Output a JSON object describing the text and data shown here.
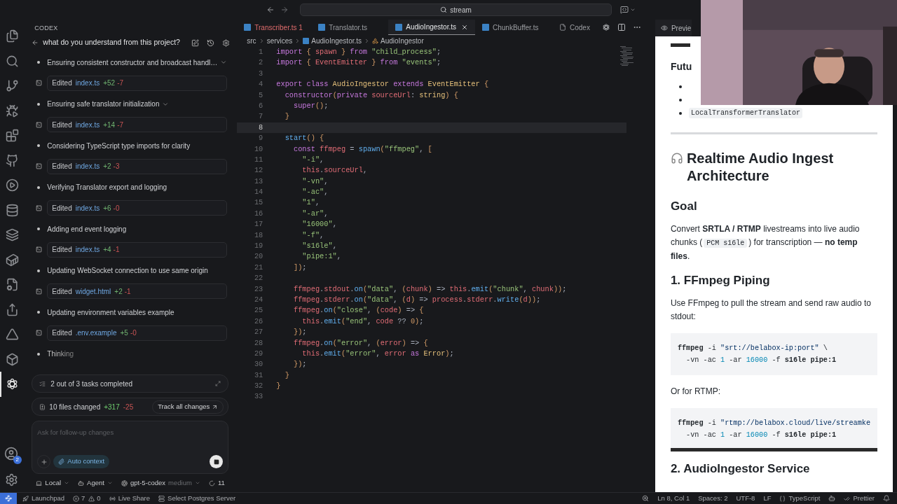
{
  "title_bar": {
    "search": "stream"
  },
  "activity_bar": {
    "items": [
      {
        "kind": "files",
        "selected": false
      },
      {
        "kind": "search",
        "selected": false
      },
      {
        "kind": "branch",
        "selected": false
      },
      {
        "kind": "debug",
        "selected": false
      },
      {
        "kind": "blocks",
        "selected": false
      },
      {
        "kind": "github",
        "selected": false
      },
      {
        "kind": "play",
        "selected": false
      },
      {
        "kind": "database",
        "selected": false
      },
      {
        "kind": "layers",
        "selected": false
      },
      {
        "kind": "container",
        "selected": false
      },
      {
        "kind": "filecog",
        "selected": false
      },
      {
        "kind": "remote",
        "selected": false
      },
      {
        "kind": "triangle",
        "selected": false
      },
      {
        "kind": "box",
        "selected": false
      },
      {
        "kind": "knot",
        "selected": true
      }
    ],
    "account_badge": "2"
  },
  "codex": {
    "header": "CODEX",
    "thread_title": "what do you understand from this project?",
    "timeline": [
      {
        "kind": "step",
        "text": "Ensuring consistent constructor and broadcast handl…",
        "expandable": true
      },
      {
        "kind": "edit",
        "action": "Edited",
        "file": "index.ts",
        "added": "+52",
        "removed": "-7"
      },
      {
        "kind": "step",
        "text": "Ensuring safe translator initialization",
        "expandable": true
      },
      {
        "kind": "edit",
        "action": "Edited",
        "file": "index.ts",
        "added": "+14",
        "removed": "-7"
      },
      {
        "kind": "step",
        "text": "Considering TypeScript type imports for clarity",
        "expandable": false
      },
      {
        "kind": "edit",
        "action": "Edited",
        "file": "index.ts",
        "added": "+2",
        "removed": "-3"
      },
      {
        "kind": "step",
        "text": "Verifying Translator export and logging",
        "expandable": false
      },
      {
        "kind": "edit",
        "action": "Edited",
        "file": "index.ts",
        "added": "+6",
        "removed": "-0"
      },
      {
        "kind": "step",
        "text": "Adding end event logging",
        "expandable": false
      },
      {
        "kind": "edit",
        "action": "Edited",
        "file": "index.ts",
        "added": "+4",
        "removed": "-1"
      },
      {
        "kind": "step",
        "text": "Updating WebSocket connection to use same origin",
        "expandable": false
      },
      {
        "kind": "edit",
        "action": "Edited",
        "file": "widget.html",
        "added": "+2",
        "removed": "-1"
      },
      {
        "kind": "step",
        "text": "Updating environment variables example",
        "expandable": false
      },
      {
        "kind": "edit",
        "action": "Edited",
        "file": ".env.example",
        "added": "+5",
        "removed": "-0"
      },
      {
        "kind": "thinking",
        "text": "Thinking"
      }
    ],
    "tasks": "2 out of 3 tasks completed",
    "changes": {
      "summary": "10 files changed",
      "added": "+317",
      "removed": "-25",
      "button": "Track all changes"
    },
    "input": {
      "placeholder": "Ask for follow-up changes",
      "context_chip": "Auto context"
    },
    "footer": [
      {
        "kind": "local",
        "label": "Local"
      },
      {
        "kind": "agent",
        "label": "Agent"
      },
      {
        "kind": "model",
        "label": "gpt-5-codex",
        "detail": "medium"
      },
      {
        "kind": "usage",
        "label": "11"
      }
    ]
  },
  "editor": {
    "tabs": [
      {
        "kind": "ts",
        "label": "Transcriber.ts",
        "problems": "1",
        "error": true,
        "selected": false
      },
      {
        "kind": "ts",
        "label": "Translator.ts",
        "error": false,
        "selected": false
      },
      {
        "kind": "ts",
        "label": "AudioIngestor.ts",
        "error": false,
        "selected": true
      },
      {
        "kind": "ts",
        "label": "ChunkBuffer.ts",
        "error": false,
        "selected": false
      },
      {
        "kind": "doc",
        "label": "Codex",
        "error": false,
        "selected": false
      }
    ],
    "breadcrumb": [
      {
        "kind": "folder",
        "label": "src"
      },
      {
        "kind": "folder",
        "label": "services"
      },
      {
        "kind": "file",
        "label": "AudioIngestor.ts"
      },
      {
        "kind": "symbol",
        "label": "AudioIngestor"
      }
    ],
    "lines": [
      {
        "n": "1",
        "current": false,
        "tokens": [
          {
            "kind": "kw",
            "text": "import"
          },
          {
            "kind": "br",
            "text": " {"
          },
          {
            "kind": "var",
            "text": " spawn"
          },
          {
            "kind": "br",
            "text": " }"
          },
          {
            "kind": "kw",
            "text": " from"
          },
          {
            "kind": "str",
            "text": " \"child_process\""
          },
          {
            "kind": "p",
            "text": ";"
          }
        ]
      },
      {
        "n": "2",
        "current": false,
        "tokens": [
          {
            "kind": "kw",
            "text": "import"
          },
          {
            "kind": "br",
            "text": " {"
          },
          {
            "kind": "var",
            "text": " EventEmitter"
          },
          {
            "kind": "br",
            "text": " }"
          },
          {
            "kind": "kw",
            "text": " from"
          },
          {
            "kind": "str",
            "text": " \"events\""
          },
          {
            "kind": "p",
            "text": ";"
          }
        ]
      },
      {
        "n": "3",
        "current": false
      },
      {
        "n": "4",
        "current": false,
        "tokens": [
          {
            "kind": "kw",
            "text": "export"
          },
          {
            "kind": "kw",
            "text": " class"
          },
          {
            "kind": "cls",
            "text": " AudioIngestor"
          },
          {
            "kind": "kw",
            "text": " extends"
          },
          {
            "kind": "cls",
            "text": " EventEmitter"
          },
          {
            "kind": "br",
            "text": " {"
          }
        ]
      },
      {
        "n": "5",
        "current": false,
        "tokens": [
          {
            "kind": "kw",
            "text": "  constructor"
          },
          {
            "kind": "br",
            "text": "("
          },
          {
            "kind": "kw",
            "text": "private"
          },
          {
            "kind": "var",
            "text": " sourceUrl"
          },
          {
            "kind": "p",
            "text": ":"
          },
          {
            "kind": "cls",
            "text": " string"
          },
          {
            "kind": "br",
            "text": ")"
          },
          {
            "kind": "br",
            "text": " {"
          }
        ]
      },
      {
        "n": "6",
        "current": false,
        "tokens": [
          {
            "kind": "kw",
            "text": "    super"
          },
          {
            "kind": "br",
            "text": "()"
          },
          {
            "kind": "p",
            "text": ";"
          }
        ]
      },
      {
        "n": "7",
        "current": false,
        "tokens": [
          {
            "kind": "br",
            "text": "  }"
          }
        ]
      },
      {
        "n": "8",
        "current": true
      },
      {
        "n": "9",
        "current": false,
        "tokens": [
          {
            "kind": "fn",
            "text": "  start"
          },
          {
            "kind": "br",
            "text": "()"
          },
          {
            "kind": "br",
            "text": " {"
          }
        ]
      },
      {
        "n": "10",
        "current": false,
        "tokens": [
          {
            "kind": "kw",
            "text": "    const"
          },
          {
            "kind": "var",
            "text": " ffmpeg"
          },
          {
            "kind": "p",
            "text": " ="
          },
          {
            "kind": "fn",
            "text": " spawn"
          },
          {
            "kind": "br",
            "text": "("
          },
          {
            "kind": "str",
            "text": "\"ffmpeg\""
          },
          {
            "kind": "p",
            "text": ","
          },
          {
            "kind": "br",
            "text": " ["
          }
        ]
      },
      {
        "n": "11",
        "current": false,
        "tokens": [
          {
            "kind": "str",
            "text": "      \"-i\""
          },
          {
            "kind": "p",
            "text": ","
          }
        ]
      },
      {
        "n": "12",
        "current": false,
        "tokens": [
          {
            "kind": "var",
            "text": "      this"
          },
          {
            "kind": "p",
            "text": "."
          },
          {
            "kind": "var",
            "text": "sourceUrl"
          },
          {
            "kind": "p",
            "text": ","
          }
        ]
      },
      {
        "n": "13",
        "current": false,
        "tokens": [
          {
            "kind": "str",
            "text": "      \"-vn\""
          },
          {
            "kind": "p",
            "text": ","
          }
        ]
      },
      {
        "n": "14",
        "current": false,
        "tokens": [
          {
            "kind": "str",
            "text": "      \"-ac\""
          },
          {
            "kind": "p",
            "text": ","
          }
        ]
      },
      {
        "n": "15",
        "current": false,
        "tokens": [
          {
            "kind": "str",
            "text": "      \"1\""
          },
          {
            "kind": "p",
            "text": ","
          }
        ]
      },
      {
        "n": "16",
        "current": false,
        "tokens": [
          {
            "kind": "str",
            "text": "      \"-ar\""
          },
          {
            "kind": "p",
            "text": ","
          }
        ]
      },
      {
        "n": "17",
        "current": false,
        "tokens": [
          {
            "kind": "str",
            "text": "      \"16000\""
          },
          {
            "kind": "p",
            "text": ","
          }
        ]
      },
      {
        "n": "18",
        "current": false,
        "tokens": [
          {
            "kind": "str",
            "text": "      \"-f\""
          },
          {
            "kind": "p",
            "text": ","
          }
        ]
      },
      {
        "n": "19",
        "current": false,
        "tokens": [
          {
            "kind": "str",
            "text": "      \"s16le\""
          },
          {
            "kind": "p",
            "text": ","
          }
        ]
      },
      {
        "n": "20",
        "current": false,
        "tokens": [
          {
            "kind": "str",
            "text": "      \"pipe:1\""
          },
          {
            "kind": "p",
            "text": ","
          }
        ]
      },
      {
        "n": "21",
        "current": false,
        "tokens": [
          {
            "kind": "br",
            "text": "    ])"
          },
          {
            "kind": "p",
            "text": ";"
          }
        ]
      },
      {
        "n": "22",
        "current": false
      },
      {
        "n": "23",
        "current": false,
        "tokens": [
          {
            "kind": "var",
            "text": "    ffmpeg"
          },
          {
            "kind": "p",
            "text": "."
          },
          {
            "kind": "var",
            "text": "stdout"
          },
          {
            "kind": "p",
            "text": "."
          },
          {
            "kind": "fn",
            "text": "on"
          },
          {
            "kind": "br",
            "text": "("
          },
          {
            "kind": "str",
            "text": "\"data\""
          },
          {
            "kind": "p",
            "text": ","
          },
          {
            "kind": "br",
            "text": " ("
          },
          {
            "kind": "var",
            "text": "chunk"
          },
          {
            "kind": "br",
            "text": ")"
          },
          {
            "kind": "p",
            "text": " =>"
          },
          {
            "kind": "var",
            "text": " this"
          },
          {
            "kind": "p",
            "text": "."
          },
          {
            "kind": "fn",
            "text": "emit"
          },
          {
            "kind": "br",
            "text": "("
          },
          {
            "kind": "str",
            "text": "\"chunk\""
          },
          {
            "kind": "p",
            "text": ","
          },
          {
            "kind": "var",
            "text": " chunk"
          },
          {
            "kind": "br",
            "text": "))"
          },
          {
            "kind": "p",
            "text": ";"
          }
        ]
      },
      {
        "n": "24",
        "current": false,
        "tokens": [
          {
            "kind": "var",
            "text": "    ffmpeg"
          },
          {
            "kind": "p",
            "text": "."
          },
          {
            "kind": "var",
            "text": "stderr"
          },
          {
            "kind": "p",
            "text": "."
          },
          {
            "kind": "fn",
            "text": "on"
          },
          {
            "kind": "br",
            "text": "("
          },
          {
            "kind": "str",
            "text": "\"data\""
          },
          {
            "kind": "p",
            "text": ","
          },
          {
            "kind": "br",
            "text": " ("
          },
          {
            "kind": "var",
            "text": "d"
          },
          {
            "kind": "br",
            "text": ")"
          },
          {
            "kind": "p",
            "text": " =>"
          },
          {
            "kind": "var",
            "text": " process"
          },
          {
            "kind": "p",
            "text": "."
          },
          {
            "kind": "var",
            "text": "stderr"
          },
          {
            "kind": "p",
            "text": "."
          },
          {
            "kind": "fn",
            "text": "write"
          },
          {
            "kind": "br",
            "text": "("
          },
          {
            "kind": "var",
            "text": "d"
          },
          {
            "kind": "br",
            "text": "))"
          },
          {
            "kind": "p",
            "text": ";"
          }
        ]
      },
      {
        "n": "25",
        "current": false,
        "tokens": [
          {
            "kind": "var",
            "text": "    ffmpeg"
          },
          {
            "kind": "p",
            "text": "."
          },
          {
            "kind": "fn",
            "text": "on"
          },
          {
            "kind": "br",
            "text": "("
          },
          {
            "kind": "str",
            "text": "\"close\""
          },
          {
            "kind": "p",
            "text": ","
          },
          {
            "kind": "br",
            "text": " ("
          },
          {
            "kind": "var",
            "text": "code"
          },
          {
            "kind": "br",
            "text": ")"
          },
          {
            "kind": "p",
            "text": " =>"
          },
          {
            "kind": "br",
            "text": " {"
          }
        ]
      },
      {
        "n": "26",
        "current": false,
        "tokens": [
          {
            "kind": "var",
            "text": "      this"
          },
          {
            "kind": "p",
            "text": "."
          },
          {
            "kind": "fn",
            "text": "emit"
          },
          {
            "kind": "br",
            "text": "("
          },
          {
            "kind": "str",
            "text": "\"end\""
          },
          {
            "kind": "p",
            "text": ","
          },
          {
            "kind": "var",
            "text": " code"
          },
          {
            "kind": "p",
            "text": " ??"
          },
          {
            "kind": "num",
            "text": " 0"
          },
          {
            "kind": "br",
            "text": ")"
          },
          {
            "kind": "p",
            "text": ";"
          }
        ]
      },
      {
        "n": "27",
        "current": false,
        "tokens": [
          {
            "kind": "br",
            "text": "    })"
          },
          {
            "kind": "p",
            "text": ";"
          }
        ]
      },
      {
        "n": "28",
        "current": false,
        "tokens": [
          {
            "kind": "var",
            "text": "    ffmpeg"
          },
          {
            "kind": "p",
            "text": "."
          },
          {
            "kind": "fn",
            "text": "on"
          },
          {
            "kind": "br",
            "text": "("
          },
          {
            "kind": "str",
            "text": "\"error\""
          },
          {
            "kind": "p",
            "text": ","
          },
          {
            "kind": "br",
            "text": " ("
          },
          {
            "kind": "var",
            "text": "error"
          },
          {
            "kind": "br",
            "text": ")"
          },
          {
            "kind": "p",
            "text": " =>"
          },
          {
            "kind": "br",
            "text": " {"
          }
        ]
      },
      {
        "n": "29",
        "current": false,
        "tokens": [
          {
            "kind": "var",
            "text": "      this"
          },
          {
            "kind": "p",
            "text": "."
          },
          {
            "kind": "fn",
            "text": "emit"
          },
          {
            "kind": "br",
            "text": "("
          },
          {
            "kind": "str",
            "text": "\"error\""
          },
          {
            "kind": "p",
            "text": ","
          },
          {
            "kind": "var",
            "text": " error"
          },
          {
            "kind": "kw",
            "text": " as"
          },
          {
            "kind": "cls",
            "text": " Error"
          },
          {
            "kind": "br",
            "text": ")"
          },
          {
            "kind": "p",
            "text": ";"
          }
        ]
      },
      {
        "n": "30",
        "current": false,
        "tokens": [
          {
            "kind": "br",
            "text": "    })"
          },
          {
            "kind": "p",
            "text": ";"
          }
        ]
      },
      {
        "n": "31",
        "current": false,
        "tokens": [
          {
            "kind": "br",
            "text": "  }"
          }
        ]
      },
      {
        "n": "32",
        "current": false,
        "tokens": [
          {
            "kind": "br",
            "text": "}"
          }
        ]
      },
      {
        "n": "33",
        "current": false
      }
    ]
  },
  "preview": {
    "tab": "Previe",
    "blocks": [
      {
        "kind": "scrollbar"
      },
      {
        "kind": "h3",
        "text": "Futu"
      },
      {
        "kind": "list",
        "items": [
          {
            "kind": "covered"
          },
          {
            "kind": "covered"
          },
          {
            "kind": "code",
            "text": "LocalTransformerTranslator"
          }
        ]
      },
      {
        "kind": "hr"
      },
      {
        "kind": "h1",
        "text": "Realtime Audio Ingest Architecture"
      },
      {
        "kind": "h2",
        "text": "Goal"
      },
      {
        "kind": "p",
        "parts": [
          {
            "kind": "text",
            "text": "Convert **SRTLA / RTMP** livestreams into live audio chunks ("
          },
          {
            "kind": "code",
            "text": "PCM s16le"
          },
          {
            "kind": "text",
            "text": ") for transcription — **no temp files**."
          }
        ]
      },
      {
        "kind": "h2",
        "text": "1. FFmpeg Piping"
      },
      {
        "kind": "p",
        "parts": [
          {
            "kind": "text",
            "text": "Use FFmpeg to pull the stream and send raw audio to stdout:"
          }
        ]
      },
      {
        "kind": "code",
        "scrollable": false,
        "lines": [
          {
            "tokens": [
              {
                "kind": "cmd",
                "text": "ffmpeg"
              },
              {
                "kind": "p",
                "text": " -i"
              },
              {
                "kind": "str",
                "text": " \"srt://belabox-ip:port\""
              },
              {
                "kind": "p",
                "text": " \\"
              }
            ]
          },
          {
            "tokens": [
              {
                "kind": "p",
                "text": "  -vn -ac"
              },
              {
                "kind": "num",
                "text": " 1"
              },
              {
                "kind": "p",
                "text": " -ar"
              },
              {
                "kind": "num",
                "text": " 16000"
              },
              {
                "kind": "p",
                "text": " -f"
              },
              {
                "kind": "cmd",
                "text": " s16le pipe:1"
              }
            ]
          }
        ]
      },
      {
        "kind": "p",
        "parts": [
          {
            "kind": "text",
            "text": "Or for RTMP:"
          }
        ]
      },
      {
        "kind": "code",
        "scrollable": true,
        "lines": [
          {
            "tokens": [
              {
                "kind": "cmd",
                "text": "ffmpeg"
              },
              {
                "kind": "p",
                "text": " -i"
              },
              {
                "kind": "str",
                "text": " \"rtmp://belabox.cloud/live/streamke"
              }
            ]
          },
          {
            "tokens": [
              {
                "kind": "p",
                "text": "  -vn -ac"
              },
              {
                "kind": "num",
                "text": " 1"
              },
              {
                "kind": "p",
                "text": " -ar"
              },
              {
                "kind": "num",
                "text": " 16000"
              },
              {
                "kind": "p",
                "text": " -f"
              },
              {
                "kind": "cmd",
                "text": " s16le pipe:1"
              }
            ]
          }
        ]
      },
      {
        "kind": "h2",
        "text": "2. AudioIngestor Service"
      }
    ]
  },
  "status_bar": {
    "left": [
      {
        "kind": "launchpad",
        "label": "Launchpad"
      },
      {
        "kind": "problems",
        "errors": "7",
        "warnings": "0"
      },
      {
        "kind": "liveshare",
        "label": "Live Share"
      },
      {
        "kind": "postgres",
        "label": "Select Postgres Server"
      }
    ],
    "right": [
      {
        "kind": "zoom"
      },
      {
        "kind": "text",
        "label": "Ln 8, Col 1"
      },
      {
        "kind": "text",
        "label": "Spaces: 2"
      },
      {
        "kind": "text",
        "label": "UTF-8"
      },
      {
        "kind": "text",
        "label": "LF"
      },
      {
        "kind": "language",
        "label": "TypeScript"
      },
      {
        "kind": "copilot"
      },
      {
        "kind": "prettier",
        "label": "Prettier"
      },
      {
        "kind": "bell"
      }
    ]
  }
}
